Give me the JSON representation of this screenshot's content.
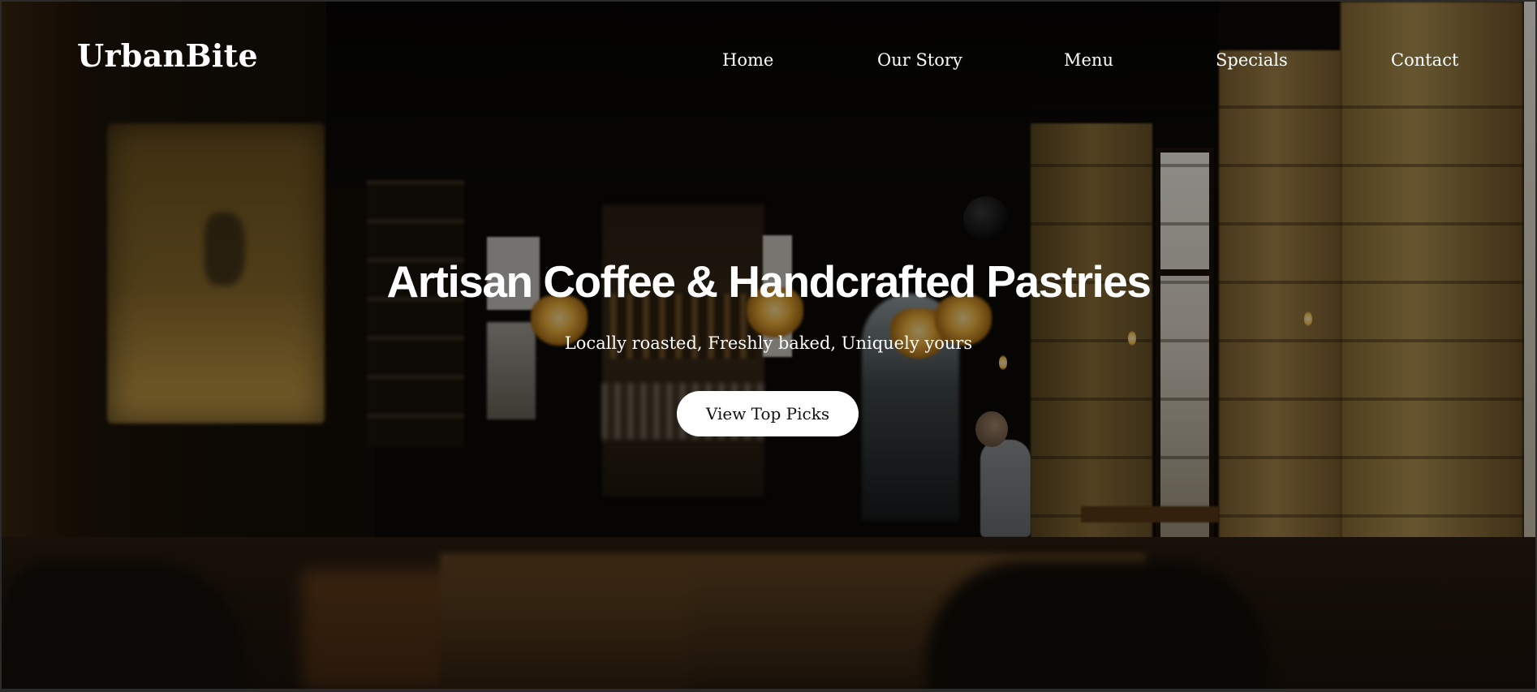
{
  "brand": {
    "name": "UrbanBite"
  },
  "nav": {
    "items": [
      {
        "label": "Home"
      },
      {
        "label": "Our Story"
      },
      {
        "label": "Menu"
      },
      {
        "label": "Specials"
      },
      {
        "label": "Contact"
      }
    ]
  },
  "hero": {
    "title": "Artisan Coffee & Handcrafted Pastries",
    "subtitle": "Locally roasted, Freshly baked, Uniquely yours",
    "cta_label": "View Top Picks",
    "background": "cafe-interior-photo"
  },
  "colors": {
    "text": "#ffffff",
    "button_bg": "#ffffff",
    "button_text": "#111111",
    "frame": "#2b2b2b"
  }
}
